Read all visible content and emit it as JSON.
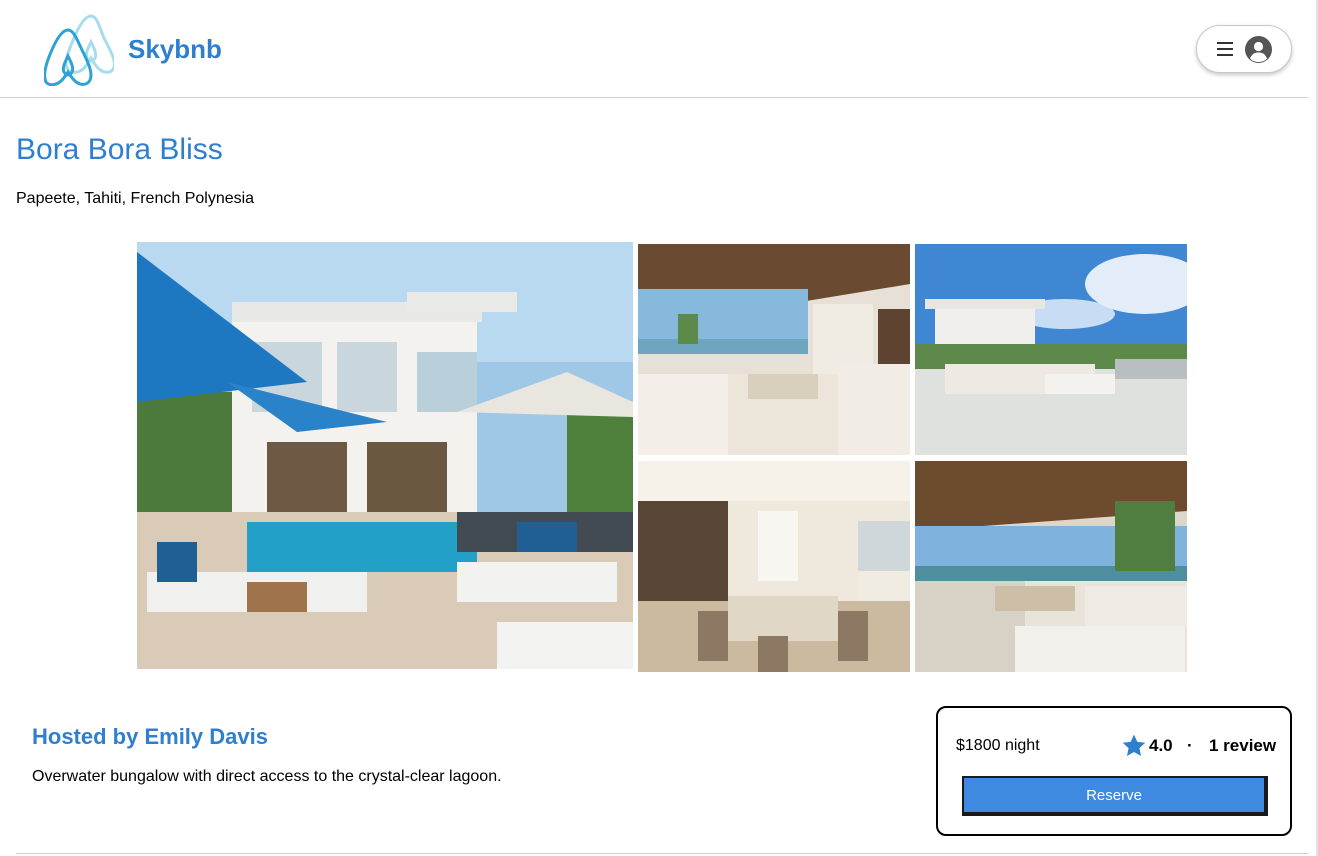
{
  "header": {
    "brand": "Skybnb",
    "icons": {
      "logo": "skybnb-logo-icon",
      "menu": "hamburger-menu-icon",
      "account": "user-avatar-icon"
    }
  },
  "listing": {
    "title": "Bora Bora Bliss",
    "location": "Papeete, Tahiti, French Polynesia",
    "photos": [
      {
        "name": "photo-main",
        "subject": "villa-pool-exterior"
      },
      {
        "name": "photo-2",
        "subject": "covered-terrace-lounge"
      },
      {
        "name": "photo-3",
        "subject": "rooftop-terrace"
      },
      {
        "name": "photo-4",
        "subject": "dining-room-interior"
      },
      {
        "name": "photo-5",
        "subject": "covered-patio-sofas"
      }
    ],
    "host": "Hosted by Emily Davis",
    "description": "Overwater bungalow with direct access to the crystal-clear lagoon."
  },
  "booking": {
    "price": "$1800 night",
    "rating": "4.0",
    "separator": "·",
    "reviews": "1 review",
    "reserve_label": "Reserve",
    "star_icon": "star-icon"
  },
  "colors": {
    "accent": "#2f7fd1",
    "button": "#3d8ae0",
    "border": "#000000",
    "divider": "#cfcfcf"
  }
}
